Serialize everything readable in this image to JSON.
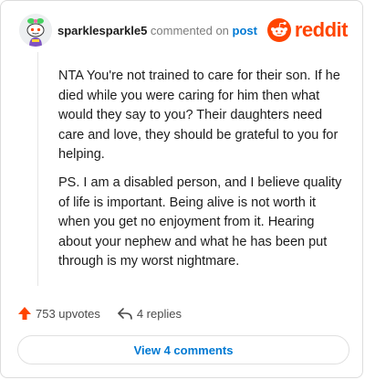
{
  "header": {
    "username": "sparklesparkle5",
    "commented_text": "commented on",
    "post_link": "post",
    "brand": "reddit"
  },
  "comment": {
    "paragraphs": [
      "NTA You're not trained to care for their son. If he died while you were caring for him then what would they say to you? Their daughters need care and love, they should be grateful to you for helping.",
      "PS. I am a disabled person, and I believe quality of life is important. Being alive is not worth it when you get no enjoyment from it. Hearing about your nephew and what he has been put through is my worst nightmare."
    ]
  },
  "footer": {
    "upvotes": "753 upvotes",
    "replies": "4 replies",
    "view_comments": "View 4 comments"
  },
  "colors": {
    "brand": "#ff4500",
    "link": "#0079d3",
    "upvote": "#ff4500"
  },
  "icons": {
    "upvote": "upvote-arrow-icon",
    "reply": "reply-arrow-icon",
    "logo": "reddit-snoo-icon"
  }
}
